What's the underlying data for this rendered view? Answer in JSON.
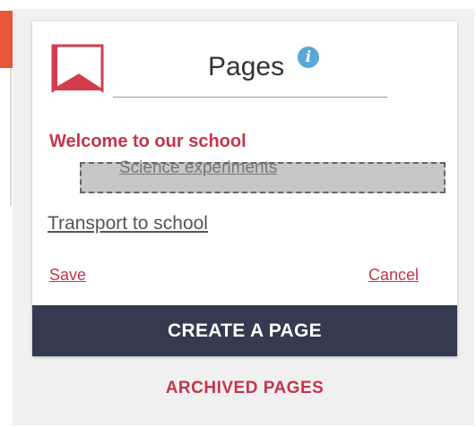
{
  "header": {
    "title": "Pages"
  },
  "pages": {
    "active": "Welcome to our school",
    "dragging": "Science experiments",
    "items": [
      "Transport to school"
    ]
  },
  "actions": {
    "save": "Save",
    "cancel": "Cancel",
    "create_page": "CREATE A PAGE",
    "archived_pages": "ARCHIVED PAGES"
  },
  "icons": {
    "info": "info-icon",
    "logo": "page-logo-icon"
  },
  "colors": {
    "accent": "#c4354c",
    "button_bg": "#343a4f",
    "info": "#58a8d8",
    "tab": "#e8563b"
  }
}
